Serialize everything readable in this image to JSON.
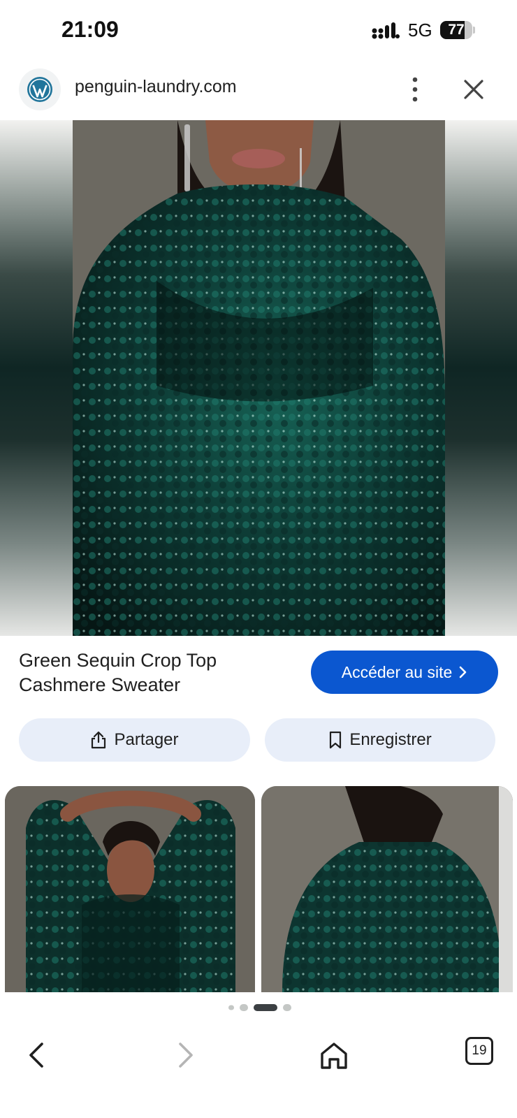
{
  "status_bar": {
    "time": "21:09",
    "network": "5G",
    "battery_level": "77",
    "battery_fraction": 0.77
  },
  "browser": {
    "url": "penguin-laundry.com",
    "site_icon": "wordpress-icon",
    "menu_icon": "more-vert-icon",
    "close_icon": "close-icon"
  },
  "product": {
    "title_line1": "Green Sequin Crop Top",
    "title_line2": "Cashmere Sweater",
    "visit_label": "Accéder au site",
    "share_label": "Partager",
    "save_label": "Enregistrer"
  },
  "carousel": {
    "total": 4,
    "active_index": 2
  },
  "bottom_nav": {
    "tab_count": "19",
    "icons": [
      "back-icon",
      "forward-icon",
      "home-icon",
      "tabs-icon"
    ]
  },
  "colors": {
    "accent": "#0b57d0",
    "pill_bg": "#e8eef9",
    "sequin_green": "#0f4a42"
  }
}
